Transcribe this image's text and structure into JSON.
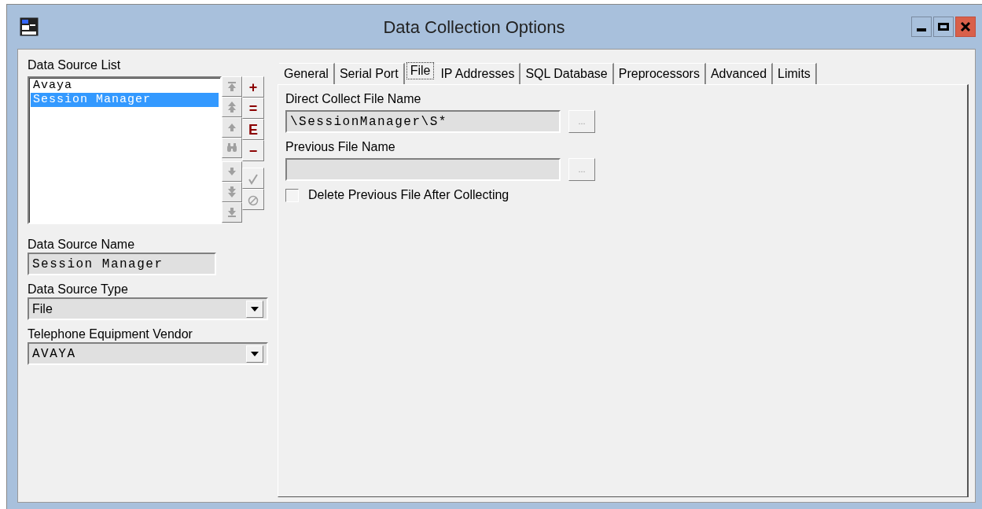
{
  "window": {
    "title": "Data Collection Options",
    "controls": [
      {
        "kind": "minimize"
      },
      {
        "kind": "maximize"
      },
      {
        "kind": "close"
      }
    ]
  },
  "data_source_list": {
    "label": "Data Source List",
    "items": [
      {
        "text": "Avaya",
        "selected": false
      },
      {
        "text": "Session Manager",
        "selected": true
      }
    ],
    "move_buttons": [
      {
        "kind": "top",
        "disabled": true
      },
      {
        "kind": "page-up",
        "disabled": true
      },
      {
        "kind": "up",
        "disabled": true
      },
      {
        "kind": "find",
        "disabled": true
      },
      {
        "kind": "down",
        "disabled": true
      },
      {
        "kind": "page-down",
        "disabled": true
      },
      {
        "kind": "bottom",
        "disabled": true
      }
    ],
    "edit_buttons": [
      {
        "label": "+"
      },
      {
        "label": "="
      },
      {
        "label": "E"
      },
      {
        "label": "−"
      }
    ],
    "confirm_buttons": [
      {
        "kind": "accept",
        "disabled": true
      },
      {
        "kind": "cancel",
        "disabled": true
      }
    ]
  },
  "data_source_name": {
    "label": "Data Source Name",
    "value": "Session Manager"
  },
  "data_source_type": {
    "label": "Data Source Type",
    "value": "File"
  },
  "vendor": {
    "label": "Telephone Equipment Vendor",
    "value": "AVAYA"
  },
  "tabs": [
    {
      "label": "General",
      "selected": false
    },
    {
      "label": "Serial Port",
      "selected": false
    },
    {
      "label": "File",
      "selected": true
    },
    {
      "label": "IP Addresses",
      "selected": false
    },
    {
      "label": "SQL Database",
      "selected": false
    },
    {
      "label": "Preprocessors",
      "selected": false
    },
    {
      "label": "Advanced",
      "selected": false
    },
    {
      "label": "Limits",
      "selected": false
    }
  ],
  "file_tab": {
    "fields": [
      {
        "label": "Direct Collect File Name",
        "value": "\\SessionManager\\S*",
        "browse": "..."
      },
      {
        "label": "Previous File Name",
        "browse": "..."
      }
    ],
    "delete_checkbox": {
      "label": "Delete Previous File After Collecting",
      "checked": false
    }
  }
}
